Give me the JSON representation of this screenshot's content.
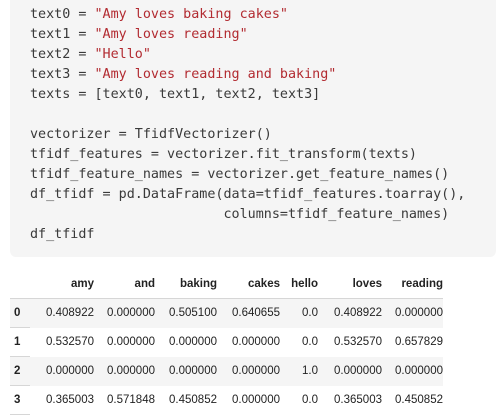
{
  "code_lines": [
    "text0 = \"Amy loves baking cakes\"",
    "text1 = \"Amy loves reading\"",
    "text2 = \"Hello\"",
    "text3 = \"Amy loves reading and baking\"",
    "texts = [text0, text1, text2, text3]",
    "",
    "vectorizer = TfidfVectorizer()",
    "tfidf_features = vectorizer.fit_transform(texts)",
    "tfidf_feature_names = vectorizer.get_feature_names()",
    "df_tfidf = pd.DataFrame(data=tfidf_features.toarray(),",
    "                        columns=tfidf_feature_names)",
    "df_tfidf"
  ],
  "string_color": "#b22b31",
  "table": {
    "columns": [
      "amy",
      "and",
      "baking",
      "cakes",
      "hello",
      "loves",
      "reading"
    ],
    "rows": [
      {
        "index": "0",
        "values": [
          "0.408922",
          "0.000000",
          "0.505100",
          "0.640655",
          "0.0",
          "0.408922",
          "0.000000"
        ]
      },
      {
        "index": "1",
        "values": [
          "0.532570",
          "0.000000",
          "0.000000",
          "0.000000",
          "0.0",
          "0.532570",
          "0.657829"
        ]
      },
      {
        "index": "2",
        "values": [
          "0.000000",
          "0.000000",
          "0.000000",
          "0.000000",
          "1.0",
          "0.000000",
          "0.000000"
        ]
      },
      {
        "index": "3",
        "values": [
          "0.365003",
          "0.571848",
          "0.450852",
          "0.000000",
          "0.0",
          "0.365003",
          "0.450852"
        ]
      }
    ]
  }
}
